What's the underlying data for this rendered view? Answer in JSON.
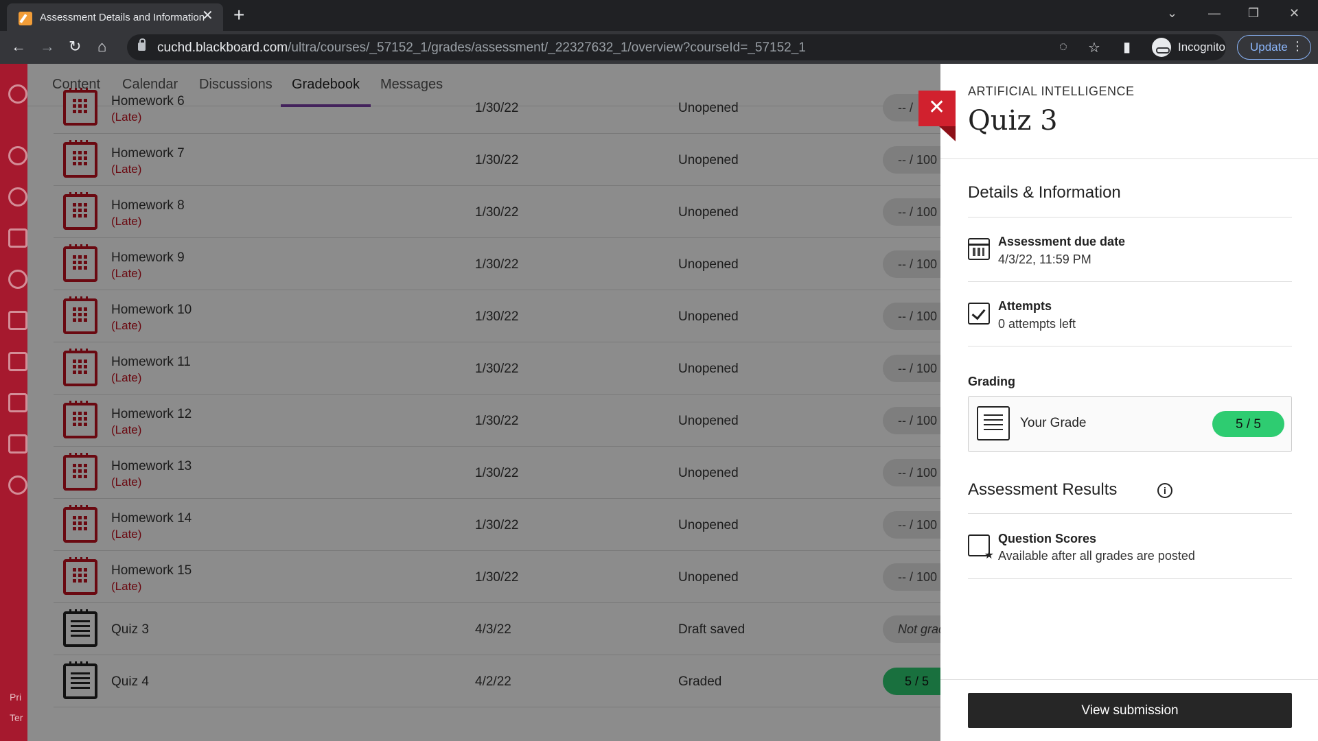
{
  "browser": {
    "tab_title": "Assessment Details and Information",
    "url_host": "cuchd.blackboard.com",
    "url_path": "/ultra/courses/_57152_1/grades/assessment/_22327632_1/overview?courseId=_57152_1",
    "incognito_label": "Incognito",
    "update_label": "Update"
  },
  "nav": {
    "tabs": [
      {
        "label": "Content"
      },
      {
        "label": "Calendar"
      },
      {
        "label": "Discussions"
      },
      {
        "label": "Gradebook"
      },
      {
        "label": "Messages"
      }
    ],
    "active_tab": "Gradebook"
  },
  "leftnav": {
    "footer": [
      "Pri",
      "Ter"
    ]
  },
  "grades": [
    {
      "name": "Homework 6",
      "late": "(Late)",
      "date": "1/30/22",
      "status": "Unopened",
      "grade": "-- /"
    },
    {
      "name": "Homework 7",
      "late": "(Late)",
      "date": "1/30/22",
      "status": "Unopened",
      "grade": "-- / 100"
    },
    {
      "name": "Homework 8",
      "late": "(Late)",
      "date": "1/30/22",
      "status": "Unopened",
      "grade": "-- / 100"
    },
    {
      "name": "Homework 9",
      "late": "(Late)",
      "date": "1/30/22",
      "status": "Unopened",
      "grade": "-- / 100"
    },
    {
      "name": "Homework 10",
      "late": "(Late)",
      "date": "1/30/22",
      "status": "Unopened",
      "grade": "-- / 100"
    },
    {
      "name": "Homework 11",
      "late": "(Late)",
      "date": "1/30/22",
      "status": "Unopened",
      "grade": "-- / 100"
    },
    {
      "name": "Homework 12",
      "late": "(Late)",
      "date": "1/30/22",
      "status": "Unopened",
      "grade": "-- / 100"
    },
    {
      "name": "Homework 13",
      "late": "(Late)",
      "date": "1/30/22",
      "status": "Unopened",
      "grade": "-- / 100"
    },
    {
      "name": "Homework 14",
      "late": "(Late)",
      "date": "1/30/22",
      "status": "Unopened",
      "grade": "-- / 100"
    },
    {
      "name": "Homework 15",
      "late": "(Late)",
      "date": "1/30/22",
      "status": "Unopened",
      "grade": "-- / 100"
    },
    {
      "name": "Quiz 3",
      "late": "",
      "date": "4/3/22",
      "status": "Draft saved",
      "grade": "Not grad"
    },
    {
      "name": "Quiz 4",
      "late": "",
      "date": "4/2/22",
      "status": "Graded",
      "grade": "5 / 5"
    }
  ],
  "panel": {
    "course": "ARTIFICIAL INTELLIGENCE",
    "title": "Quiz 3",
    "details_heading": "Details & Information",
    "due_title": "Assessment due date",
    "due_value": "4/3/22, 11:59 PM",
    "attempts_title": "Attempts",
    "attempts_value": "0 attempts left",
    "grading_label": "Grading",
    "your_grade_label": "Your Grade",
    "your_grade_value": "5 / 5",
    "results_heading": "Assessment Results",
    "qs_title": "Question Scores",
    "qs_value": "Available after all grades are posted",
    "view_button": "View submission"
  },
  "colors": {
    "accent": "#7b3ea8",
    "brand": "#a6192e",
    "grade_green": "#2ecc71",
    "close_red": "#d1212e"
  }
}
